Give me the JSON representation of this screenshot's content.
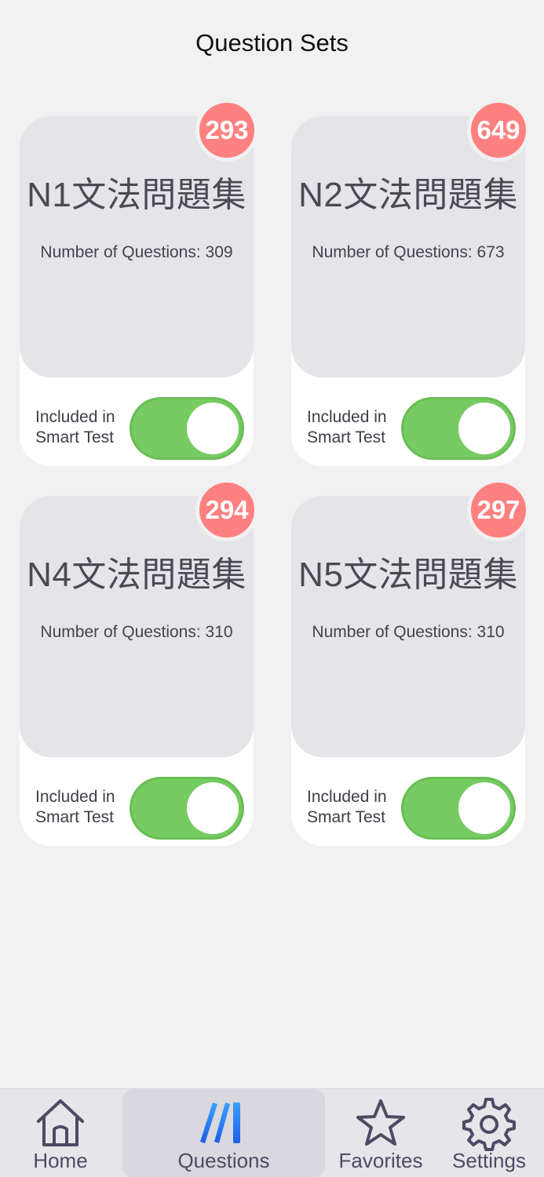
{
  "header": {
    "title": "Question Sets"
  },
  "cards": [
    {
      "title": "N1文法問題集",
      "count_text": "Number of Questions: 309",
      "badge": "293",
      "toggle_label_line1": "Included in",
      "toggle_label_line2": "Smart Test",
      "toggle_on": true
    },
    {
      "title": "N2文法問題集",
      "count_text": "Number of Questions: 673",
      "badge": "649",
      "toggle_label_line1": "Included in",
      "toggle_label_line2": "Smart Test",
      "toggle_on": true
    },
    {
      "title": "N4文法問題集",
      "count_text": "Number of Questions: 310",
      "badge": "294",
      "toggle_label_line1": "Included in",
      "toggle_label_line2": "Smart Test",
      "toggle_on": true
    },
    {
      "title": "N5文法問題集",
      "count_text": "Number of Questions: 310",
      "badge": "297",
      "toggle_label_line1": "Included in",
      "toggle_label_line2": "Smart Test",
      "toggle_on": true
    }
  ],
  "tabbar": {
    "items": [
      {
        "label": "Home",
        "icon": "home-icon",
        "active": false
      },
      {
        "label": "Questions",
        "icon": "questions-icon",
        "active": true
      },
      {
        "label": "Favorites",
        "icon": "star-icon",
        "active": false
      },
      {
        "label": "Settings",
        "icon": "gear-icon",
        "active": false
      }
    ]
  },
  "colors": {
    "badge": "#ff8080",
    "toggle_on": "#76cb62",
    "card_top": "#e4e4e9",
    "tab_icon": "#4d4b63",
    "active_icon": "#1e6cf0"
  }
}
